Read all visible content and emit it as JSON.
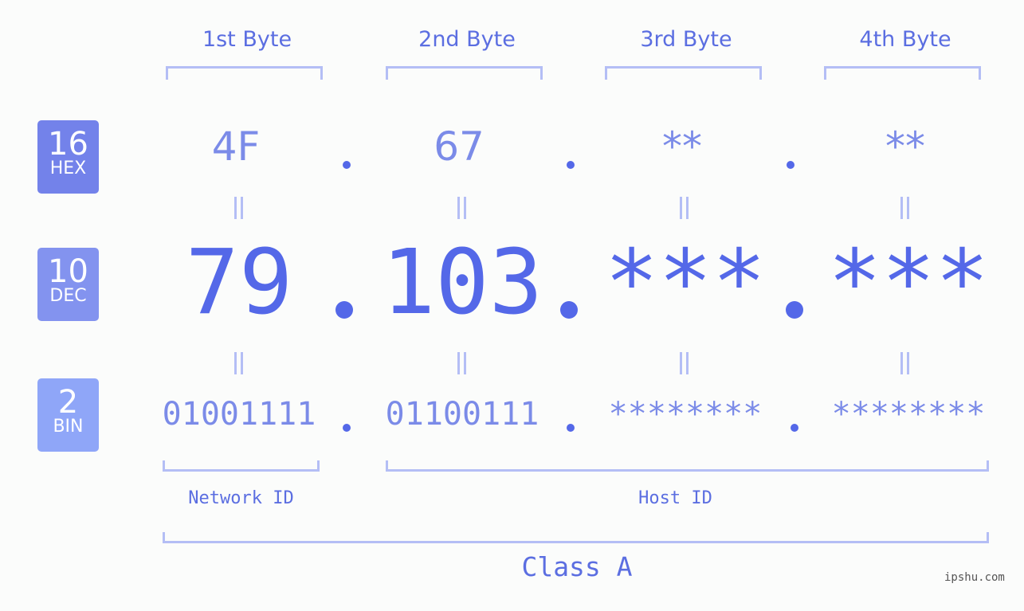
{
  "byte_headers": [
    "1st Byte",
    "2nd Byte",
    "3rd Byte",
    "4th Byte"
  ],
  "badges": [
    {
      "number": "16",
      "label": "HEX",
      "color": "#7382ea"
    },
    {
      "number": "10",
      "label": "DEC",
      "color": "#8393ef"
    },
    {
      "number": "2",
      "label": "BIN",
      "color": "#8fa6f8"
    }
  ],
  "hex_values": [
    "4F",
    "67",
    "**",
    "**"
  ],
  "dec_values": [
    "79",
    "103",
    "***",
    "***"
  ],
  "bin_values": [
    "01001111",
    "01100111",
    "********",
    "********"
  ],
  "network_id_label": "Network ID",
  "host_id_label": "Host ID",
  "class_label": "Class A",
  "watermark": "ipshu.com",
  "colors": {
    "accent": "#5468e8",
    "label_text": "#5b6ee1",
    "light_value": "#7b8be8",
    "bracket": "#b4bef5",
    "background": "#fbfcfb"
  }
}
